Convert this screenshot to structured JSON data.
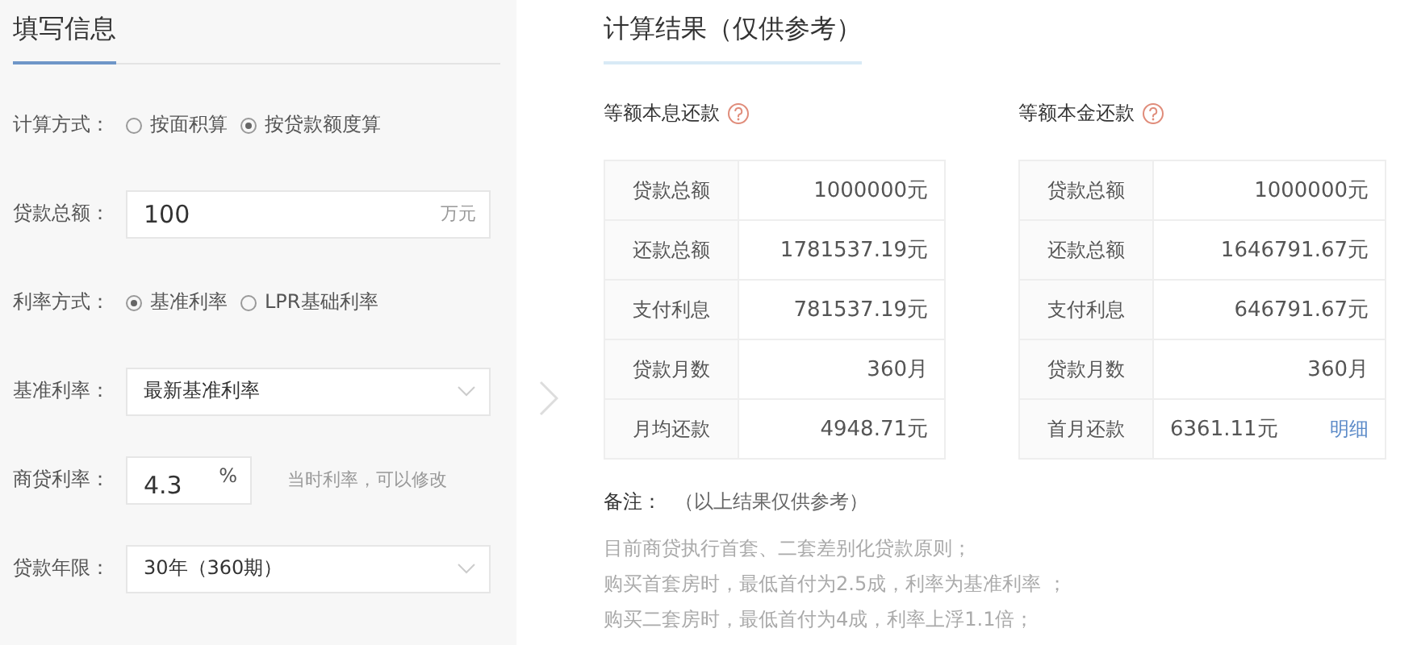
{
  "form": {
    "title": "填写信息",
    "rows": [
      {
        "kind": "radio",
        "label": "计算方式：",
        "options": [
          {
            "label": "按面积算",
            "selected": false
          },
          {
            "label": "按贷款额度算",
            "selected": true
          }
        ]
      },
      {
        "kind": "input",
        "label": "贷款总额：",
        "value": "100",
        "unit": "万元"
      },
      {
        "kind": "radio",
        "label": "利率方式：",
        "options": [
          {
            "label": "基准利率",
            "selected": true
          },
          {
            "label": "LPR基础利率",
            "selected": false
          }
        ]
      },
      {
        "kind": "select",
        "label": "基准利率：",
        "value": "最新基准利率"
      },
      {
        "kind": "rate",
        "label": "商贷利率：",
        "value": "4.3",
        "unit": "%",
        "hint": "当时利率，可以修改"
      },
      {
        "kind": "select",
        "label": "贷款年限：",
        "value": "30年（360期）"
      }
    ]
  },
  "result": {
    "title": "计算结果（仅供参考）",
    "tables": [
      {
        "title": "等额本息还款",
        "rows": [
          {
            "label": "贷款总额",
            "value": "1000000元"
          },
          {
            "label": "还款总额",
            "value": "1781537.19元"
          },
          {
            "label": "支付利息",
            "value": "781537.19元"
          },
          {
            "label": "贷款月数",
            "value": "360月"
          },
          {
            "label": "月均还款",
            "value": "4948.71元"
          }
        ]
      },
      {
        "title": "等额本金还款",
        "rows": [
          {
            "label": "贷款总额",
            "value": "1000000元"
          },
          {
            "label": "还款总额",
            "value": "1646791.67元"
          },
          {
            "label": "支付利息",
            "value": "646791.67元"
          },
          {
            "label": "贷款月数",
            "value": "360月"
          },
          {
            "label": "首月还款",
            "value": "6361.11元",
            "link": "明细"
          }
        ]
      }
    ],
    "note": {
      "label": "备注：",
      "text": "（以上结果仅供参考）",
      "lines": [
        "目前商贷执行首套、二套差别化贷款原则；",
        "购买首套房时，最低首付为2.5成，利率为基准利率 ；",
        "购买二套房时，最低首付为4成，利率上浮1.1倍；"
      ]
    }
  }
}
